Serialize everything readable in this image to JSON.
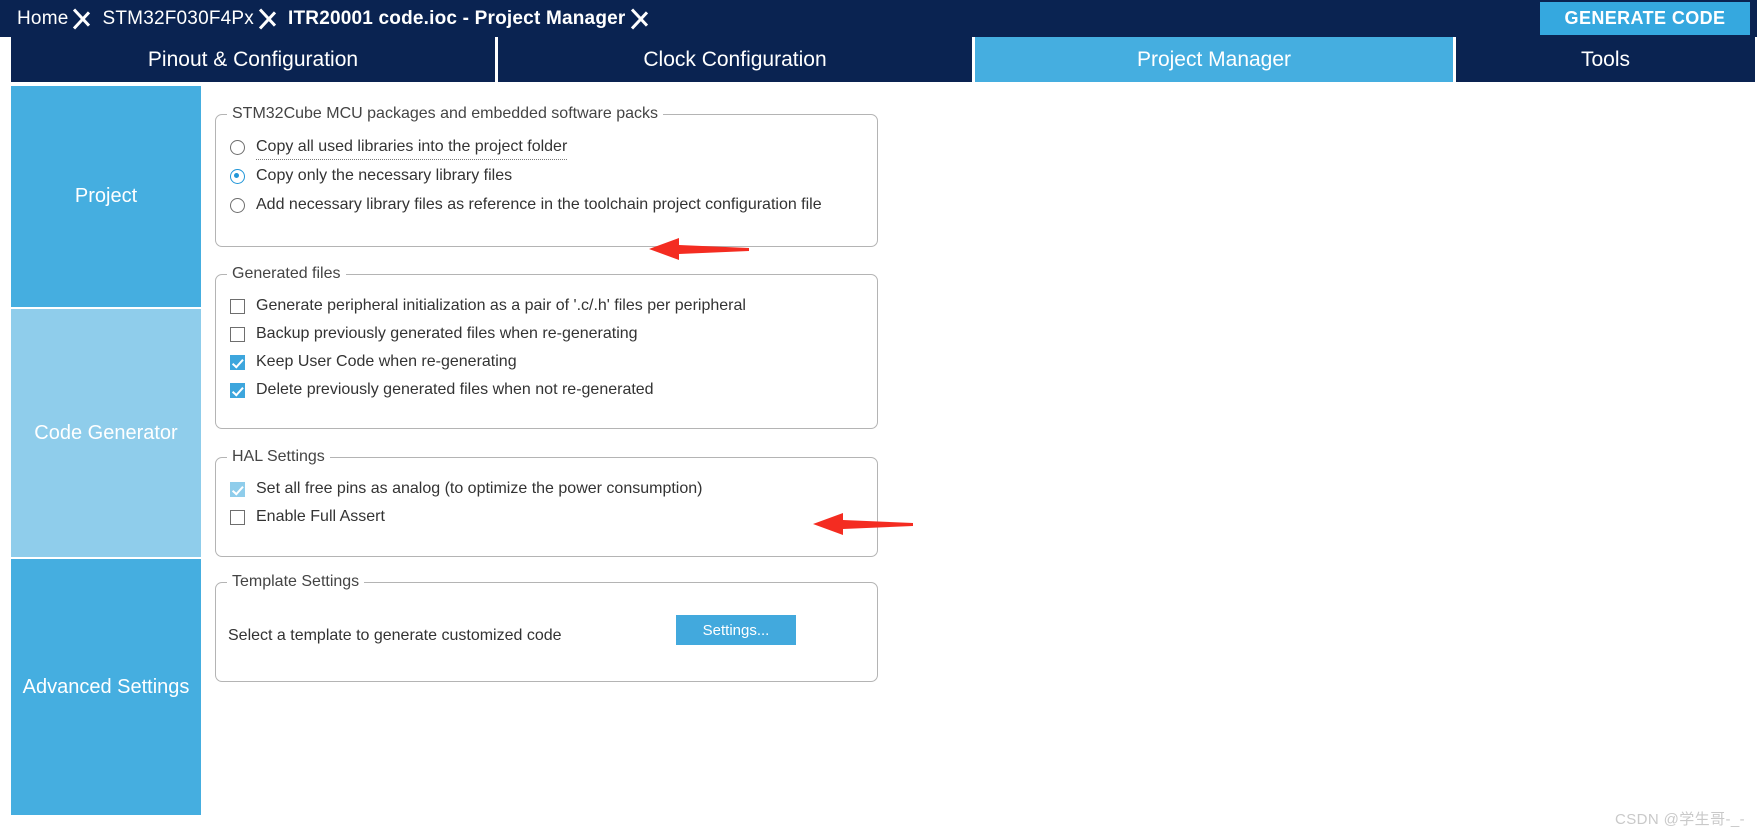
{
  "breadcrumb": {
    "items": [
      {
        "label": "Home",
        "bold": false
      },
      {
        "label": "STM32F030F4Px",
        "bold": false
      },
      {
        "label": "ITR20001 code.ioc - Project Manager",
        "bold": true
      }
    ],
    "generate_code_label": "GENERATE CODE"
  },
  "tabs": [
    {
      "label": "Pinout & Configuration",
      "active": false
    },
    {
      "label": "Clock Configuration",
      "active": false
    },
    {
      "label": "Project Manager",
      "active": true
    },
    {
      "label": "Tools",
      "active": false
    }
  ],
  "sidebar": {
    "items": [
      {
        "label": "Project",
        "selected": false
      },
      {
        "label": "Code Generator",
        "selected": true
      },
      {
        "label": "Advanced Settings",
        "selected": false
      }
    ]
  },
  "groups": {
    "packages": {
      "title": "STM32Cube MCU packages and embedded software packs",
      "options": [
        {
          "label": "Copy all used libraries into the project folder",
          "checked": false,
          "focused": true
        },
        {
          "label": "Copy only the necessary library files",
          "checked": true,
          "focused": false
        },
        {
          "label": "Add necessary library files as reference in the toolchain project configuration file",
          "checked": false,
          "focused": false
        }
      ]
    },
    "generated_files": {
      "title": "Generated files",
      "options": [
        {
          "label": "Generate peripheral initialization as a pair of '.c/.h' files per peripheral",
          "checked": false,
          "dim": false
        },
        {
          "label": "Backup previously generated files when re-generating",
          "checked": false,
          "dim": false
        },
        {
          "label": "Keep User Code when re-generating",
          "checked": true,
          "dim": false
        },
        {
          "label": "Delete previously generated files when not re-generated",
          "checked": true,
          "dim": false
        }
      ]
    },
    "hal_settings": {
      "title": "HAL Settings",
      "options": [
        {
          "label": "Set all free pins as analog (to optimize the power consumption)",
          "checked": true,
          "dim": true
        },
        {
          "label": "Enable Full Assert",
          "checked": false,
          "dim": false
        }
      ]
    },
    "template_settings": {
      "title": "Template Settings",
      "description": "Select a template to generate customized code",
      "settings_button_label": "Settings..."
    }
  },
  "annotations": {
    "arrows": [
      {
        "name": "arrow-copy-only-necessary",
        "color": "#f42c21"
      },
      {
        "name": "arrow-set-free-pins-analog",
        "color": "#f42c21"
      }
    ]
  },
  "watermark": "CSDN @学生哥-_-",
  "colors": {
    "header_navy": "#0a2351",
    "accent_blue": "#45aee0",
    "selected_sidebar": "#8fcdeb",
    "checkbox_blue": "#3da6dd",
    "arrow_red": "#f42c21"
  }
}
